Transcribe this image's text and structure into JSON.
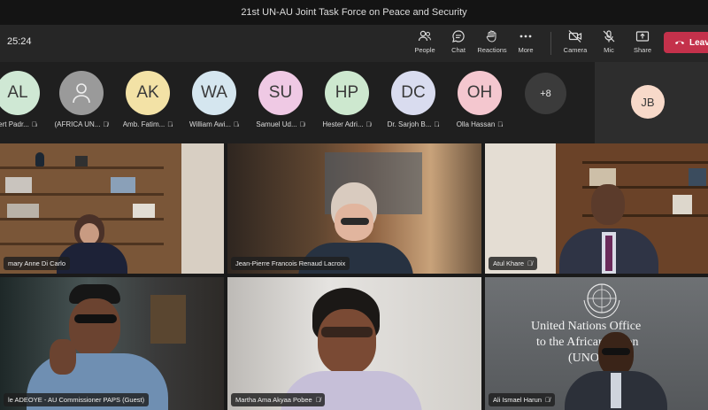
{
  "window": {
    "title": "21st UN-AU Joint Task Force on Peace and Security"
  },
  "toolbar": {
    "timer": "25:24",
    "buttons": [
      {
        "label": "People",
        "icon": "people-icon"
      },
      {
        "label": "Chat",
        "icon": "chat-icon"
      },
      {
        "label": "Reactions",
        "icon": "reactions-icon"
      },
      {
        "label": "More",
        "icon": "more-icon"
      },
      {
        "label": "Camera",
        "icon": "camera-off-icon"
      },
      {
        "label": "Mic",
        "icon": "mic-off-icon"
      },
      {
        "label": "Share",
        "icon": "share-icon"
      }
    ],
    "leave_label": "Leave"
  },
  "participants": [
    {
      "initials": "AL",
      "name": "ert Padr...",
      "color": "#cfe8d4"
    },
    {
      "initials": "",
      "name": "(AFRICA UN...",
      "color": "#9a9a9a"
    },
    {
      "initials": "AK",
      "name": "Amb. Fatim...",
      "color": "#f3e2a6"
    },
    {
      "initials": "WA",
      "name": "William Awi...",
      "color": "#d5e6ef"
    },
    {
      "initials": "SU",
      "name": "Samuel Ud...",
      "color": "#efc9e4"
    },
    {
      "initials": "HP",
      "name": "Hester Adri...",
      "color": "#cde8cf"
    },
    {
      "initials": "DC",
      "name": "Dr. Sarjoh B...",
      "color": "#d9dcef"
    },
    {
      "initials": "OH",
      "name": "Olla Hassan",
      "color": "#f4c7cf"
    }
  ],
  "overflow_count": "+8",
  "self": {
    "initials": "JB",
    "color": "#f7d9c9"
  },
  "video_tiles": [
    {
      "name": "mary Anne Di Carlo"
    },
    {
      "name": "Jean-Pierre Francois Renaud Lacroix"
    },
    {
      "name": "Atul Khare"
    },
    {
      "name": "le ADEOYE - AU Commissioner PAPS (Guest)"
    },
    {
      "name": "Martha Ama Akyaa Pobee"
    },
    {
      "name": "Ali Ismael Harun"
    }
  ],
  "background_sign": {
    "line1": "United Nations Office",
    "line2": "to the African Union",
    "line3": "(UNOAU)"
  }
}
